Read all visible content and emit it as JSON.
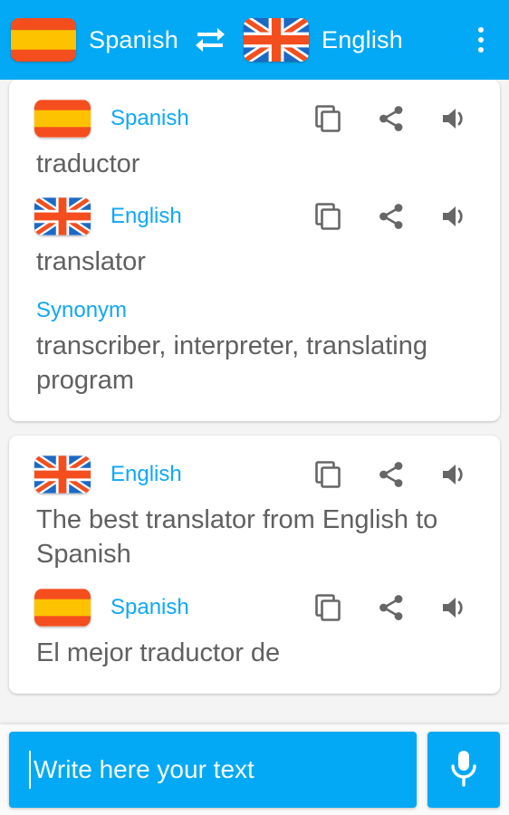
{
  "header": {
    "source_language": "Spanish",
    "source_flag": "spain-flag-icon",
    "target_language": "English",
    "target_flag": "uk-flag-icon",
    "swap_icon": "swap-arrows-icon",
    "overflow_icon": "overflow-menu-icon",
    "background_color": "#03a9f4"
  },
  "actions": {
    "copy_icon": "copy-icon",
    "share_icon": "share-icon",
    "speak_icon": "speaker-icon"
  },
  "colors": {
    "accent": "#03a9f4",
    "language_label": "#0fa8f5",
    "body_text": "#606060",
    "page_background": "#f4f4f4",
    "card_background": "#ffffff"
  },
  "cards": [
    {
      "entries": [
        {
          "language": "Spanish",
          "flag": "spain-flag-icon",
          "text": "traductor"
        },
        {
          "language": "English",
          "flag": "uk-flag-icon",
          "text": "translator"
        }
      ],
      "synonym_label": "Synonym",
      "synonym_text": "transcriber, interpreter, translating program"
    },
    {
      "entries": [
        {
          "language": "English",
          "flag": "uk-flag-icon",
          "text": "The best translator from English to Spanish"
        },
        {
          "language": "Spanish",
          "flag": "spain-flag-icon",
          "text": "El mejor traductor de"
        }
      ]
    }
  ],
  "input_bar": {
    "placeholder": "Write here your text",
    "value": "",
    "mic_icon": "microphone-icon"
  }
}
